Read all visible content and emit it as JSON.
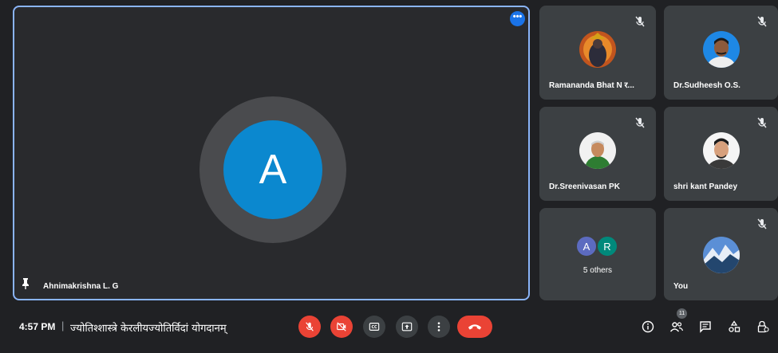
{
  "main_tile": {
    "avatar_letter": "A",
    "name": "Ahnimakrishna L. G",
    "more_label": "•••"
  },
  "tiles": [
    {
      "name": "Ramananda Bhat N र..."
    },
    {
      "name": "Dr.Sudheesh O.S."
    },
    {
      "name": "Dr.Sreenivasan PK"
    },
    {
      "name": "shri kant Pandey"
    },
    {
      "name": "You"
    }
  ],
  "others_tile": {
    "avatar_a": "A",
    "avatar_r": "R",
    "label": "5 others"
  },
  "bottom_bar": {
    "time": "4:57 PM",
    "separator": "|",
    "meeting_title": "ज्योतिश्शास्त्रे केरलीयज्योतिर्विदां योगदानम्",
    "participant_count": "11"
  },
  "colors": {
    "accent": "#8ab4f8",
    "red": "#ea4335",
    "avatar_blue": "#0b88cf",
    "avatar_purple": "#5c6bc0",
    "avatar_teal": "#00897b"
  }
}
